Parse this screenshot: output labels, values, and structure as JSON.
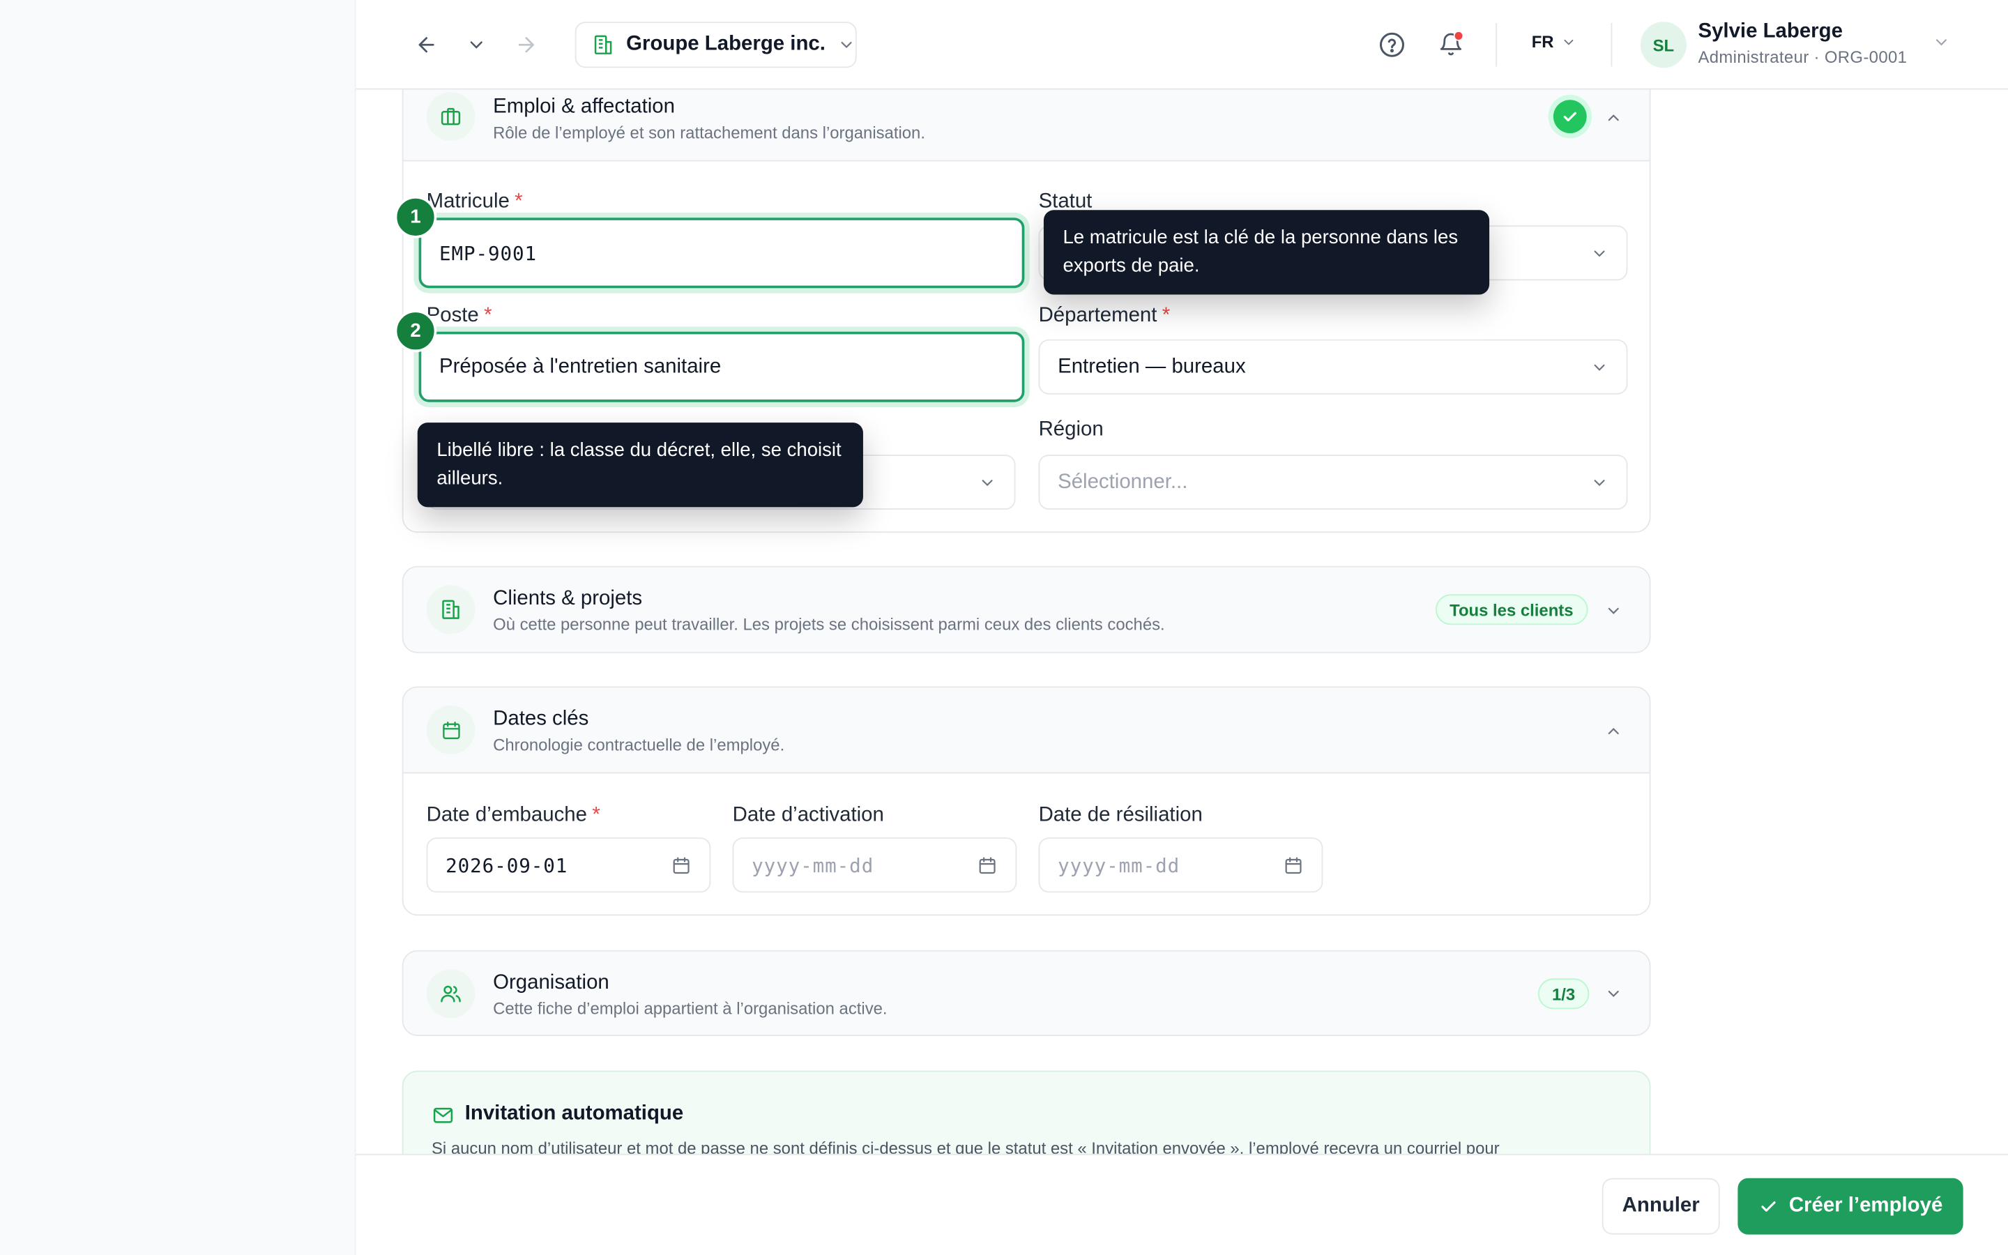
{
  "topbar": {
    "organization": "Groupe Laberge inc.",
    "language": "FR",
    "user_initials": "SL",
    "user_name": "Sylvie Laberge",
    "user_role": "Administrateur · ORG-0001"
  },
  "emploi": {
    "title": "Emploi & affectation",
    "subtitle": "Rôle de l’employé et son rattachement dans l’organisation.",
    "matricule_label": "Matricule",
    "matricule_value": "EMP-9001",
    "statut_label": "Statut",
    "poste_label": "Poste",
    "poste_value": "Préposée à l'entretien sanitaire",
    "departement_label": "Département",
    "departement_value": "Entretien — bureaux",
    "region_label": "Région",
    "region_placeholder": "Sélectionner..."
  },
  "guide": {
    "step1": "1",
    "step2": "2",
    "tooltip1": "Le matricule est la clé de la personne dans les exports de paie.",
    "tooltip2": "Libellé libre : la classe du décret, elle, se choisit ailleurs."
  },
  "clients": {
    "title": "Clients & projets",
    "subtitle": "Où cette personne peut travailler. Les projets se choisissent parmi ceux des clients cochés.",
    "badge": "Tous les clients"
  },
  "dates": {
    "title": "Dates clés",
    "subtitle": "Chronologie contractuelle de l’employé.",
    "embauche_label": "Date d’embauche",
    "embauche_value": "2026-09-01",
    "activation_label": "Date d’activation",
    "activation_placeholder": "yyyy-mm-dd",
    "resiliation_label": "Date de résiliation",
    "resiliation_placeholder": "yyyy-mm-dd"
  },
  "organisation": {
    "title": "Organisation",
    "subtitle": "Cette fiche d’emploi appartient à l’organisation active.",
    "badge": "1/3"
  },
  "invitation": {
    "title": "Invitation automatique",
    "text": "Si aucun nom d’utilisateur et mot de passe ne sont définis ci-dessus et que le statut est « Invitation envoyée », l’employé recevra un courriel pour"
  },
  "actions": {
    "cancel": "Annuler",
    "create": "Créer l’employé"
  },
  "colors": {
    "accent": "#1f9d5c",
    "tooltip_bg": "#111827",
    "required": "#ef4444"
  }
}
